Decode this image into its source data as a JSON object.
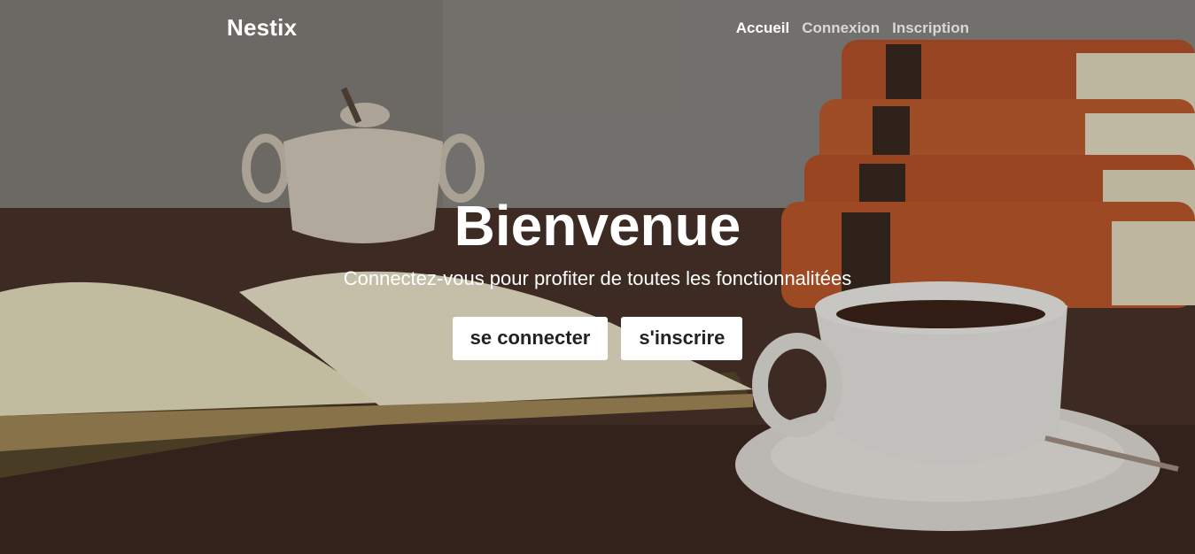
{
  "navbar": {
    "brand": "Nestix",
    "links": [
      {
        "label": "Accueil",
        "active": true
      },
      {
        "label": "Connexion",
        "active": false
      },
      {
        "label": "Inscription",
        "active": false
      }
    ]
  },
  "hero": {
    "title": "Bienvenue",
    "subtitle": "Connectez-vous pour profiter de toutes les fonctionnalitées",
    "buttons": {
      "login_label": "se connecter",
      "signup_label": "s'inscrire"
    }
  },
  "colors": {
    "text": "#ffffff",
    "button_bg": "#ffffff",
    "button_text": "#222222",
    "book_orange": "#c45a2a",
    "table_brown": "#4a3228"
  }
}
